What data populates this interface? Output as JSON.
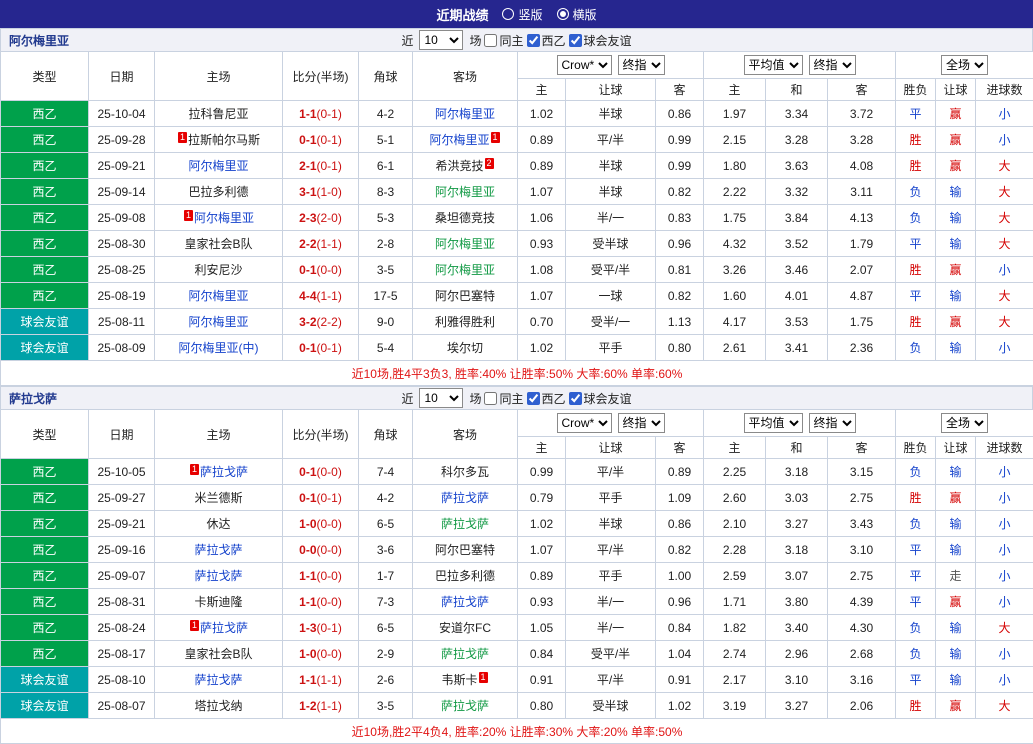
{
  "colors": {
    "topbar_bg": "#26268f",
    "league_badge": "#00a14b",
    "friendly_badge": "#00a2a8",
    "border": "#c9d2e0",
    "filter_bg": "#f0f1f7",
    "team_name_header": "#223a8f",
    "red": "#d40000",
    "blue": "#1442cc",
    "green": "#119944",
    "gray": "#555555",
    "black": "#222222",
    "score_red": "#cc1111",
    "summary_red": "#e01414",
    "card_red": "#e60000"
  },
  "top_bar": {
    "title": "近期战绩",
    "radios": [
      {
        "label": "竖版",
        "selected": false
      },
      {
        "label": "横版",
        "selected": true
      }
    ]
  },
  "filter_labels": {
    "near": "近",
    "count": "10",
    "matches": "场",
    "checkboxes": [
      {
        "label": "同主",
        "checked": false
      },
      {
        "label": "西乙",
        "checked": true
      },
      {
        "label": "球会友谊",
        "checked": true
      }
    ]
  },
  "dropdowns": {
    "asian": [
      "Crow*",
      "终指"
    ],
    "euro": [
      "平均值",
      "终指"
    ],
    "scope": [
      "全场"
    ]
  },
  "header_labels": {
    "static_cols": [
      "类型",
      "日期",
      "主场",
      "比分(半场)",
      "角球",
      "客场"
    ],
    "sub_cols_asian": [
      "主",
      "让球",
      "客"
    ],
    "sub_cols_euro": [
      "主",
      "和",
      "客"
    ],
    "sub_cols_result": [
      "胜负",
      "让球",
      "进球数"
    ]
  },
  "sections": [
    {
      "key": "almeria",
      "team": "阿尔梅里亚",
      "rows": [
        {
          "type": "西乙",
          "type_key": "league",
          "date": "25-10-04",
          "home": {
            "name": "拉科鲁尼亚",
            "color": "black"
          },
          "score": "1-1",
          "half": "(0-1)",
          "corners": "4-2",
          "away": {
            "name": "阿尔梅里亚",
            "color": "blue"
          },
          "asian": [
            "1.02",
            "半球",
            "0.86"
          ],
          "euro": [
            "1.97",
            "3.34",
            "3.72"
          ],
          "res": {
            "t": "平",
            "c": "blue"
          },
          "hc": {
            "t": "赢",
            "c": "red"
          },
          "goal": {
            "t": "小",
            "c": "blue"
          }
        },
        {
          "type": "西乙",
          "type_key": "league",
          "date": "25-09-28",
          "home": {
            "name": "拉斯帕尔马斯",
            "color": "black",
            "pre": "1"
          },
          "score": "0-1",
          "half": "(0-1)",
          "corners": "5-1",
          "away": {
            "name": "阿尔梅里亚",
            "color": "blue",
            "post": "1"
          },
          "asian": [
            "0.89",
            "平/半",
            "0.99"
          ],
          "euro": [
            "2.15",
            "3.28",
            "3.28"
          ],
          "res": {
            "t": "胜",
            "c": "red"
          },
          "hc": {
            "t": "赢",
            "c": "red"
          },
          "goal": {
            "t": "小",
            "c": "blue"
          }
        },
        {
          "type": "西乙",
          "type_key": "league",
          "date": "25-09-21",
          "home": {
            "name": "阿尔梅里亚",
            "color": "blue"
          },
          "score": "2-1",
          "half": "(0-1)",
          "corners": "6-1",
          "away": {
            "name": "希洪竞技",
            "color": "black",
            "post": "2"
          },
          "asian": [
            "0.89",
            "半球",
            "0.99"
          ],
          "euro": [
            "1.80",
            "3.63",
            "4.08"
          ],
          "res": {
            "t": "胜",
            "c": "red"
          },
          "hc": {
            "t": "赢",
            "c": "red"
          },
          "goal": {
            "t": "大",
            "c": "red"
          }
        },
        {
          "type": "西乙",
          "type_key": "league",
          "date": "25-09-14",
          "home": {
            "name": "巴拉多利德",
            "color": "black"
          },
          "score": "3-1",
          "half": "(1-0)",
          "corners": "8-3",
          "away": {
            "name": "阿尔梅里亚",
            "color": "green"
          },
          "asian": [
            "1.07",
            "半球",
            "0.82"
          ],
          "euro": [
            "2.22",
            "3.32",
            "3.11"
          ],
          "res": {
            "t": "负",
            "c": "blue"
          },
          "hc": {
            "t": "输",
            "c": "blue"
          },
          "goal": {
            "t": "大",
            "c": "red"
          }
        },
        {
          "type": "西乙",
          "type_key": "league",
          "date": "25-09-08",
          "home": {
            "name": "阿尔梅里亚",
            "color": "blue",
            "pre": "1"
          },
          "score": "2-3",
          "half": "(2-0)",
          "corners": "5-3",
          "away": {
            "name": "桑坦德竞技",
            "color": "black"
          },
          "asian": [
            "1.06",
            "半/一",
            "0.83"
          ],
          "euro": [
            "1.75",
            "3.84",
            "4.13"
          ],
          "res": {
            "t": "负",
            "c": "blue"
          },
          "hc": {
            "t": "输",
            "c": "blue"
          },
          "goal": {
            "t": "大",
            "c": "red"
          }
        },
        {
          "type": "西乙",
          "type_key": "league",
          "date": "25-08-30",
          "home": {
            "name": "皇家社会B队",
            "color": "black"
          },
          "score": "2-2",
          "half": "(1-1)",
          "corners": "2-8",
          "away": {
            "name": "阿尔梅里亚",
            "color": "green"
          },
          "asian": [
            "0.93",
            "受半球",
            "0.96"
          ],
          "euro": [
            "4.32",
            "3.52",
            "1.79"
          ],
          "res": {
            "t": "平",
            "c": "blue"
          },
          "hc": {
            "t": "输",
            "c": "blue"
          },
          "goal": {
            "t": "大",
            "c": "red"
          }
        },
        {
          "type": "西乙",
          "type_key": "league",
          "date": "25-08-25",
          "home": {
            "name": "利安尼沙",
            "color": "black"
          },
          "score": "0-1",
          "half": "(0-0)",
          "corners": "3-5",
          "away": {
            "name": "阿尔梅里亚",
            "color": "green"
          },
          "asian": [
            "1.08",
            "受平/半",
            "0.81"
          ],
          "euro": [
            "3.26",
            "3.46",
            "2.07"
          ],
          "res": {
            "t": "胜",
            "c": "red"
          },
          "hc": {
            "t": "赢",
            "c": "red"
          },
          "goal": {
            "t": "小",
            "c": "blue"
          }
        },
        {
          "type": "西乙",
          "type_key": "league",
          "date": "25-08-19",
          "home": {
            "name": "阿尔梅里亚",
            "color": "blue"
          },
          "score": "4-4",
          "half": "(1-1)",
          "corners": "17-5",
          "away": {
            "name": "阿尔巴塞特",
            "color": "black"
          },
          "asian": [
            "1.07",
            "一球",
            "0.82"
          ],
          "euro": [
            "1.60",
            "4.01",
            "4.87"
          ],
          "res": {
            "t": "平",
            "c": "blue"
          },
          "hc": {
            "t": "输",
            "c": "blue"
          },
          "goal": {
            "t": "大",
            "c": "red"
          }
        },
        {
          "type": "球会友谊",
          "type_key": "friendly",
          "date": "25-08-11",
          "home": {
            "name": "阿尔梅里亚",
            "color": "blue"
          },
          "score": "3-2",
          "half": "(2-2)",
          "corners": "9-0",
          "away": {
            "name": "利雅得胜利",
            "color": "black"
          },
          "asian": [
            "0.70",
            "受半/一",
            "1.13"
          ],
          "euro": [
            "4.17",
            "3.53",
            "1.75"
          ],
          "res": {
            "t": "胜",
            "c": "red"
          },
          "hc": {
            "t": "赢",
            "c": "red"
          },
          "goal": {
            "t": "大",
            "c": "red"
          }
        },
        {
          "type": "球会友谊",
          "type_key": "friendly",
          "date": "25-08-09",
          "home": {
            "name": "阿尔梅里亚(中)",
            "color": "blue"
          },
          "score": "0-1",
          "half": "(0-1)",
          "corners": "5-4",
          "away": {
            "name": "埃尔切",
            "color": "black"
          },
          "asian": [
            "1.02",
            "平手",
            "0.80"
          ],
          "euro": [
            "2.61",
            "3.41",
            "2.36"
          ],
          "res": {
            "t": "负",
            "c": "blue"
          },
          "hc": {
            "t": "输",
            "c": "blue"
          },
          "goal": {
            "t": "小",
            "c": "blue"
          }
        }
      ],
      "summary": "近10场,胜4平3负3, 胜率:40% 让胜率:50% 大率:60% 单率:60%"
    },
    {
      "key": "zaragoza",
      "team": "萨拉戈萨",
      "rows": [
        {
          "type": "西乙",
          "type_key": "league",
          "date": "25-10-05",
          "home": {
            "name": "萨拉戈萨",
            "color": "blue",
            "pre": "1"
          },
          "score": "0-1",
          "half": "(0-0)",
          "corners": "7-4",
          "away": {
            "name": "科尔多瓦",
            "color": "black"
          },
          "asian": [
            "0.99",
            "平/半",
            "0.89"
          ],
          "euro": [
            "2.25",
            "3.18",
            "3.15"
          ],
          "res": {
            "t": "负",
            "c": "blue"
          },
          "hc": {
            "t": "输",
            "c": "blue"
          },
          "goal": {
            "t": "小",
            "c": "blue"
          }
        },
        {
          "type": "西乙",
          "type_key": "league",
          "date": "25-09-27",
          "home": {
            "name": "米兰德斯",
            "color": "black"
          },
          "score": "0-1",
          "half": "(0-1)",
          "corners": "4-2",
          "away": {
            "name": "萨拉戈萨",
            "color": "blue"
          },
          "asian": [
            "0.79",
            "平手",
            "1.09"
          ],
          "euro": [
            "2.60",
            "3.03",
            "2.75"
          ],
          "res": {
            "t": "胜",
            "c": "red"
          },
          "hc": {
            "t": "赢",
            "c": "red"
          },
          "goal": {
            "t": "小",
            "c": "blue"
          }
        },
        {
          "type": "西乙",
          "type_key": "league",
          "date": "25-09-21",
          "home": {
            "name": "休达",
            "color": "black"
          },
          "score": "1-0",
          "half": "(0-0)",
          "corners": "6-5",
          "away": {
            "name": "萨拉戈萨",
            "color": "green"
          },
          "asian": [
            "1.02",
            "半球",
            "0.86"
          ],
          "euro": [
            "2.10",
            "3.27",
            "3.43"
          ],
          "res": {
            "t": "负",
            "c": "blue"
          },
          "hc": {
            "t": "输",
            "c": "blue"
          },
          "goal": {
            "t": "小",
            "c": "blue"
          }
        },
        {
          "type": "西乙",
          "type_key": "league",
          "date": "25-09-16",
          "home": {
            "name": "萨拉戈萨",
            "color": "blue"
          },
          "score": "0-0",
          "half": "(0-0)",
          "corners": "3-6",
          "away": {
            "name": "阿尔巴塞特",
            "color": "black"
          },
          "asian": [
            "1.07",
            "平/半",
            "0.82"
          ],
          "euro": [
            "2.28",
            "3.18",
            "3.10"
          ],
          "res": {
            "t": "平",
            "c": "blue"
          },
          "hc": {
            "t": "输",
            "c": "blue"
          },
          "goal": {
            "t": "小",
            "c": "blue"
          }
        },
        {
          "type": "西乙",
          "type_key": "league",
          "date": "25-09-07",
          "home": {
            "name": "萨拉戈萨",
            "color": "blue"
          },
          "score": "1-1",
          "half": "(0-0)",
          "corners": "1-7",
          "away": {
            "name": "巴拉多利德",
            "color": "black"
          },
          "asian": [
            "0.89",
            "平手",
            "1.00"
          ],
          "euro": [
            "2.59",
            "3.07",
            "2.75"
          ],
          "res": {
            "t": "平",
            "c": "blue"
          },
          "hc": {
            "t": "走",
            "c": "gray"
          },
          "goal": {
            "t": "小",
            "c": "blue"
          }
        },
        {
          "type": "西乙",
          "type_key": "league",
          "date": "25-08-31",
          "home": {
            "name": "卡斯迪隆",
            "color": "black"
          },
          "score": "1-1",
          "half": "(0-0)",
          "corners": "7-3",
          "away": {
            "name": "萨拉戈萨",
            "color": "blue"
          },
          "asian": [
            "0.93",
            "半/一",
            "0.96"
          ],
          "euro": [
            "1.71",
            "3.80",
            "4.39"
          ],
          "res": {
            "t": "平",
            "c": "blue"
          },
          "hc": {
            "t": "赢",
            "c": "red"
          },
          "goal": {
            "t": "小",
            "c": "blue"
          }
        },
        {
          "type": "西乙",
          "type_key": "league",
          "date": "25-08-24",
          "home": {
            "name": "萨拉戈萨",
            "color": "blue",
            "pre": "1"
          },
          "score": "1-3",
          "half": "(0-1)",
          "corners": "6-5",
          "away": {
            "name": "安道尔FC",
            "color": "black"
          },
          "asian": [
            "1.05",
            "半/一",
            "0.84"
          ],
          "euro": [
            "1.82",
            "3.40",
            "4.30"
          ],
          "res": {
            "t": "负",
            "c": "blue"
          },
          "hc": {
            "t": "输",
            "c": "blue"
          },
          "goal": {
            "t": "大",
            "c": "red"
          }
        },
        {
          "type": "西乙",
          "type_key": "league",
          "date": "25-08-17",
          "home": {
            "name": "皇家社会B队",
            "color": "black"
          },
          "score": "1-0",
          "half": "(0-0)",
          "corners": "2-9",
          "away": {
            "name": "萨拉戈萨",
            "color": "green"
          },
          "asian": [
            "0.84",
            "受平/半",
            "1.04"
          ],
          "euro": [
            "2.74",
            "2.96",
            "2.68"
          ],
          "res": {
            "t": "负",
            "c": "blue"
          },
          "hc": {
            "t": "输",
            "c": "blue"
          },
          "goal": {
            "t": "小",
            "c": "blue"
          }
        },
        {
          "type": "球会友谊",
          "type_key": "friendly",
          "date": "25-08-10",
          "home": {
            "name": "萨拉戈萨",
            "color": "blue"
          },
          "score": "1-1",
          "half": "(1-1)",
          "corners": "2-6",
          "away": {
            "name": "韦斯卡",
            "color": "black",
            "post": "1"
          },
          "asian": [
            "0.91",
            "平/半",
            "0.91"
          ],
          "euro": [
            "2.17",
            "3.10",
            "3.16"
          ],
          "res": {
            "t": "平",
            "c": "blue"
          },
          "hc": {
            "t": "输",
            "c": "blue"
          },
          "goal": {
            "t": "小",
            "c": "blue"
          }
        },
        {
          "type": "球会友谊",
          "type_key": "friendly",
          "date": "25-08-07",
          "home": {
            "name": "塔拉戈纳",
            "color": "black"
          },
          "score": "1-2",
          "half": "(1-1)",
          "corners": "3-5",
          "away": {
            "name": "萨拉戈萨",
            "color": "green"
          },
          "asian": [
            "0.80",
            "受半球",
            "1.02"
          ],
          "euro": [
            "3.19",
            "3.27",
            "2.06"
          ],
          "res": {
            "t": "胜",
            "c": "red"
          },
          "hc": {
            "t": "赢",
            "c": "red"
          },
          "goal": {
            "t": "大",
            "c": "red"
          }
        }
      ],
      "summary": "近10场,胜2平4负4, 胜率:20% 让胜率:30% 大率:20% 单率:50%"
    }
  ]
}
